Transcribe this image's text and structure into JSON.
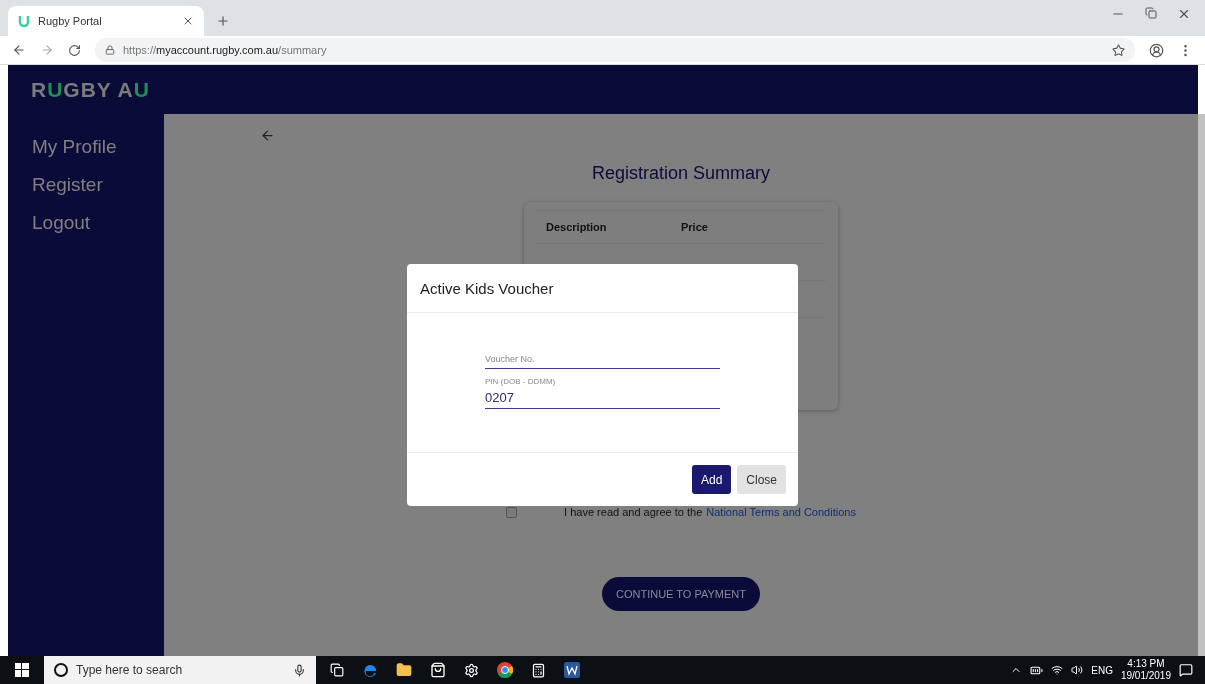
{
  "browser": {
    "tab": {
      "title": "Rugby Portal"
    },
    "url": "https://**myaccount.rugby.com.au**/summary"
  },
  "header": {
    "logo": [
      {
        "text": "R",
        "accent": false
      },
      {
        "text": "U",
        "accent": true
      },
      {
        "text": "GBY A",
        "accent": false
      },
      {
        "text": "U",
        "accent": true
      }
    ]
  },
  "sidebar": {
    "items": [
      {
        "label": "My Profile"
      },
      {
        "label": "Register"
      },
      {
        "label": "Logout"
      }
    ]
  },
  "main": {
    "title": "Registration Summary",
    "table": {
      "columns": [
        "Description",
        "Price"
      ]
    },
    "terms": {
      "checked": false,
      "text": "I have read and agree to the",
      "link": "National Terms and Conditions"
    },
    "continue_button": "CONTINUE TO PAYMENT"
  },
  "dialog": {
    "title": "Active Kids Voucher",
    "fields": [
      {
        "placeholder": "Voucher No."
      },
      {
        "label": "PIN (DOB - DDMM)",
        "value": "0207"
      }
    ],
    "buttons": [
      {
        "label": "Add",
        "kind": "primary"
      },
      {
        "label": "Close",
        "kind": "secondary"
      }
    ]
  },
  "taskbar": {
    "search_placeholder": "Type here to search",
    "language": "ENG",
    "time": "4:13 PM",
    "date": "19/01/2019"
  }
}
